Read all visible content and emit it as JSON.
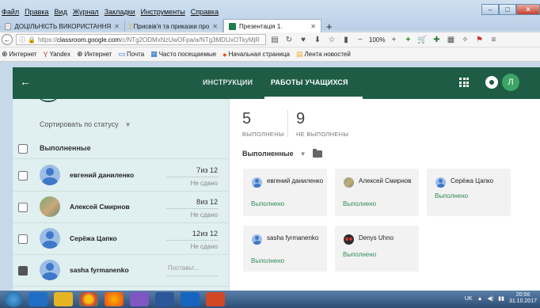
{
  "browser": {
    "menu": [
      "Файл",
      "Правка",
      "Вид",
      "Журнал",
      "Закладки",
      "Инструменты",
      "Справка"
    ],
    "tabs": [
      {
        "label": "ДОЦІЛЬНІСТЬ ВИКОРИСТАННЯ",
        "icon_color": "#e8e8e8"
      },
      {
        "label": "Присвів'я та приказки про",
        "icon_color": "#f4c20d"
      },
      {
        "label": "Презентація 1.",
        "icon_color": "#1e7e4e"
      }
    ],
    "new_tab": "+",
    "url_host": "classroom.google.com",
    "url_prefix": "https://",
    "url_rest": "/c/NTg2ODMxNzUwOFpa/a/NTg3MDUxOTkyMjR",
    "zoom": "100%",
    "bookmarks": [
      {
        "label": "Интернет",
        "icon": "globe-icon",
        "glyph": "⊕"
      },
      {
        "label": "Yandex",
        "icon": "yandex-icon",
        "glyph": "Y"
      },
      {
        "label": "Интернет",
        "icon": "globe-icon",
        "glyph": "⊕"
      },
      {
        "label": "Почта",
        "icon": "mail-icon",
        "glyph": "▭"
      },
      {
        "label": "Часто посещаемые",
        "icon": "history-icon",
        "glyph": "▦"
      },
      {
        "label": "Начальная страница",
        "icon": "home-icon",
        "glyph": "●"
      },
      {
        "label": "Лента новостей",
        "icon": "feed-icon",
        "glyph": "▤"
      }
    ]
  },
  "header": {
    "tab_instructions": "ИНСТРУКЦИИ",
    "tab_works": "РАБОТЫ УЧАЩИХСЯ",
    "avatar_letter": "Л"
  },
  "left": {
    "sort_label": "Сортировать по статусу",
    "group_label": "Выполненные",
    "students": [
      {
        "name": "евгений даниленко",
        "score": "7",
        "of": "из 12",
        "status": "Не сдано",
        "avatar": "default"
      },
      {
        "name": "Алексей Смирнов",
        "score": "8",
        "of": "из 12",
        "status": "Не сдано",
        "avatar": "photo"
      },
      {
        "name": "Серёжа Цапко",
        "score": "12",
        "of": "из 12",
        "status": "Не сдано",
        "avatar": "default"
      },
      {
        "name": "sasha fyrmanenko",
        "placeholder": "Поставьт...",
        "avatar": "default"
      }
    ]
  },
  "right": {
    "done_count": "5",
    "done_label": "ВЫПОЛНЕНЫ",
    "undone_count": "9",
    "undone_label": "НЕ ВЫПОЛНЕНЫ",
    "filter_label": "Выполненные",
    "cards": [
      {
        "name": "евгений даниленко",
        "status": "Выполнено",
        "avatar": "default"
      },
      {
        "name": "Алексей Смирнов",
        "status": "Выполнено",
        "avatar": "photo"
      },
      {
        "name": "Серёжа Цапко",
        "status": "Выполнено",
        "avatar": "default"
      },
      {
        "name": "sasha fyrmanenko",
        "status": "Выполнено",
        "avatar": "default"
      },
      {
        "name": "Denys Uhno",
        "status": "Выполнено",
        "avatar": "denys"
      }
    ]
  },
  "taskbar": {
    "lang": "UK",
    "time": "20:56",
    "date": "31.10.2017"
  },
  "colors": {
    "header": "#1e5c46",
    "done_status": "#2e8b57",
    "left_panel": "#e0efef"
  }
}
